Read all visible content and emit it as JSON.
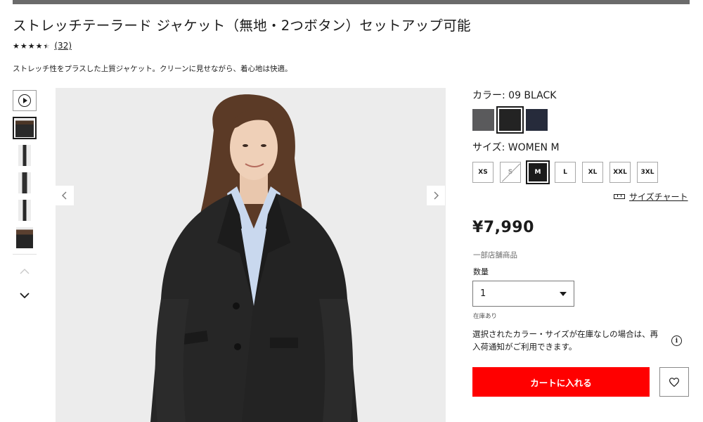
{
  "product": {
    "title": "ストレッチテーラード ジャケット（無地・2つボタン）セットアップ可能",
    "rating": 4.5,
    "review_count": "(32)",
    "description": "ストレッチ性をプラスした上質ジャケット。クリーンに見せながら、着心地は快適。"
  },
  "gallery": {
    "thumbnails": [
      "thumbnail-1",
      "thumbnail-2",
      "thumbnail-3",
      "thumbnail-4",
      "thumbnail-5"
    ],
    "prev_glyph": "‹",
    "next_glyph": "›",
    "up_glyph": "︿",
    "down_glyph": "﹀"
  },
  "color": {
    "label": "カラー: 09 BLACK",
    "swatches": [
      {
        "name": "gray",
        "hex": "#5a5a5c"
      },
      {
        "name": "black",
        "hex": "#232323"
      },
      {
        "name": "navy",
        "hex": "#262b3b"
      }
    ],
    "selected": "black"
  },
  "size": {
    "label": "サイズ: WOMEN M",
    "options": [
      "XS",
      "S",
      "M",
      "L",
      "XL",
      "XXL",
      "3XL"
    ],
    "selected": "M",
    "unavailable": [
      "S"
    ],
    "chart_label": "サイズチャート"
  },
  "purchase": {
    "price": "¥7,990",
    "stock_type": "一部店舗商品",
    "quantity_label": "数量",
    "quantity_value": "1",
    "in_stock": "在庫あり",
    "notice": "選択されたカラー・サイズが在庫なしの場合は、再入荷通知がご利用できます。",
    "cart_button": "カートに入れる",
    "accent_color": "#ff0000"
  }
}
